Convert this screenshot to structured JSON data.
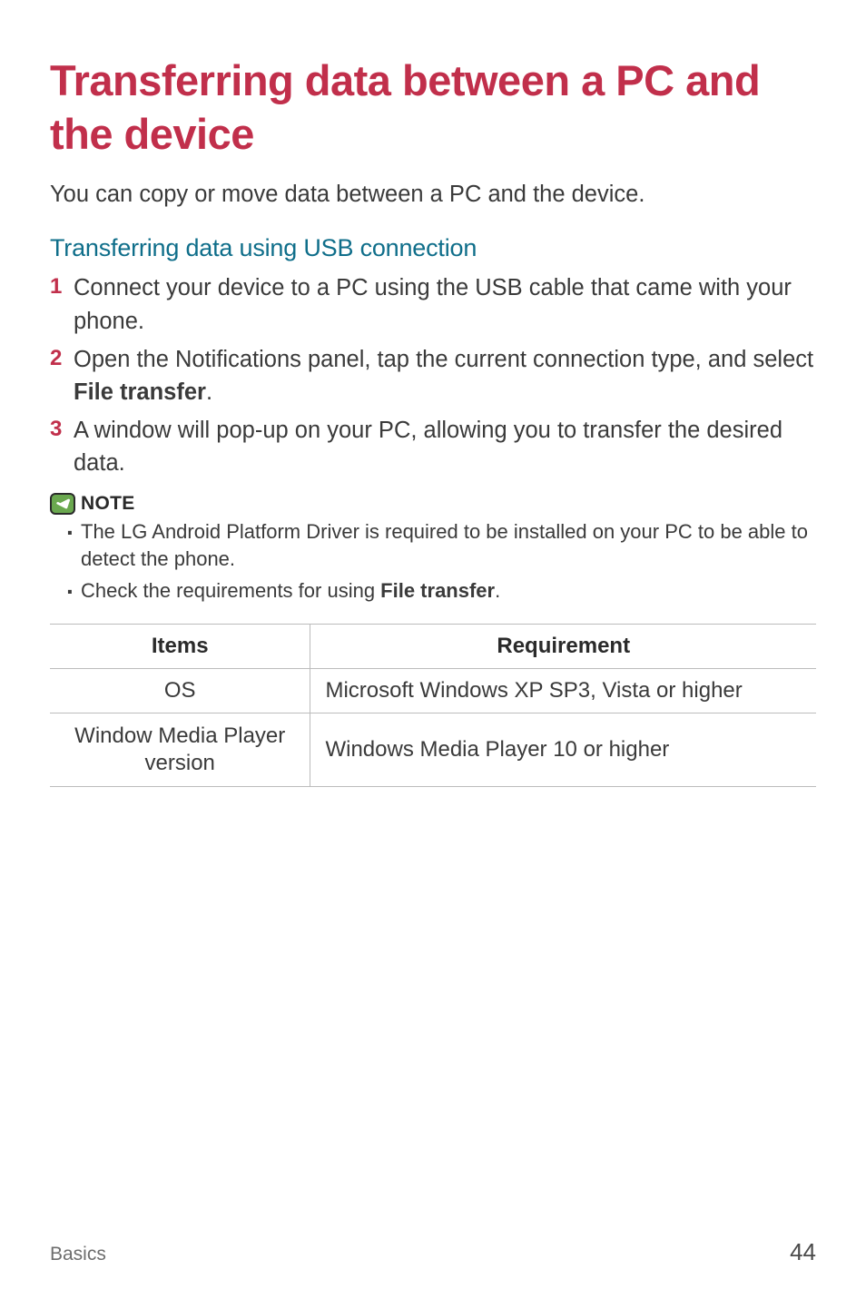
{
  "title": "Transferring data between a PC and the device",
  "intro": "You can copy or move data between a PC and the device.",
  "subhead": "Transferring data using USB connection",
  "steps": [
    {
      "num": "1",
      "text_before": "Connect your device to a PC using the USB cable that came with your phone.",
      "bold": "",
      "text_after": ""
    },
    {
      "num": "2",
      "text_before": "Open the Notifications panel, tap the current connection type, and select ",
      "bold": "File transfer",
      "text_after": "."
    },
    {
      "num": "3",
      "text_before": "A window will pop-up on your PC, allowing you to transfer the desired data.",
      "bold": "",
      "text_after": ""
    }
  ],
  "note": {
    "label": "NOTE",
    "items": [
      {
        "text_before": "The LG Android Platform Driver is required to be installed on your PC to be able to detect the phone.",
        "bold": "",
        "text_after": ""
      },
      {
        "text_before": "Check the requirements for using ",
        "bold": "File transfer",
        "text_after": "."
      }
    ]
  },
  "table": {
    "headers": {
      "col1": "Items",
      "col2": "Requirement"
    },
    "rows": [
      {
        "item": "OS",
        "requirement": "Microsoft Windows XP SP3, Vista or higher"
      },
      {
        "item": "Window Media Player version",
        "requirement": "Windows Media Player 10 or higher"
      }
    ]
  },
  "footer": {
    "section": "Basics",
    "page": "44"
  }
}
